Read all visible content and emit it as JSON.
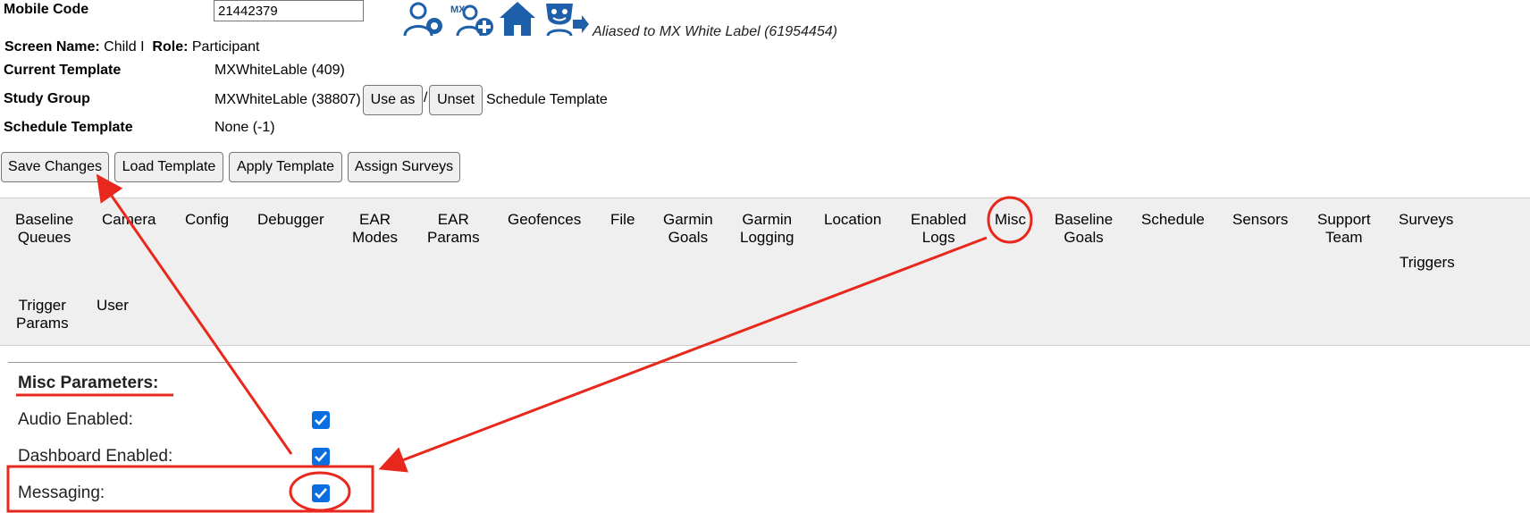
{
  "header": {
    "mobile_code_label": "Mobile Code",
    "mobile_code_value": "21442379",
    "screen_name_label": "Screen Name:",
    "screen_name_value": "Child I",
    "role_label": "Role:",
    "role_value": "Participant",
    "current_template_label": "Current Template",
    "current_template_value": "MXWhiteLable (409)",
    "study_group_label": "Study Group",
    "study_group_value": "MXWhiteLable (38807)",
    "use_as_label": "Use as",
    "slash": "/",
    "unset_label": "Unset",
    "schedule_template_suffix": "Schedule Template",
    "schedule_template_label": "Schedule Template",
    "schedule_template_value": "None (-1)",
    "alias_text": "Aliased to MX White Label (61954454)",
    "icons": [
      "participant-settings-icon",
      "mx-add-user-icon",
      "home-icon",
      "mask-forward-icon"
    ]
  },
  "actions": {
    "save": "Save Changes",
    "load": "Load Template",
    "apply": "Apply Template",
    "assign": "Assign Surveys"
  },
  "tabs": [
    {
      "line1": "Baseline",
      "line2": "Queues"
    },
    {
      "line1": "Camera",
      "line2": ""
    },
    {
      "line1": "Config",
      "line2": ""
    },
    {
      "line1": "Debugger",
      "line2": ""
    },
    {
      "line1": "EAR",
      "line2": "Modes"
    },
    {
      "line1": "EAR",
      "line2": "Params"
    },
    {
      "line1": "Geofences",
      "line2": ""
    },
    {
      "line1": "File",
      "line2": ""
    },
    {
      "line1": "Garmin",
      "line2": "Goals"
    },
    {
      "line1": "Garmin",
      "line2": "Logging"
    },
    {
      "line1": "Location",
      "line2": ""
    },
    {
      "line1": "Enabled",
      "line2": "Logs"
    },
    {
      "line1": "Misc",
      "line2": ""
    },
    {
      "line1": "Baseline",
      "line2": "Goals"
    },
    {
      "line1": "Schedule",
      "line2": ""
    },
    {
      "line1": "Sensors",
      "line2": ""
    },
    {
      "line1": "Support",
      "line2": "Team"
    },
    {
      "line1": "Surveys",
      "line2": ""
    },
    {
      "line1": "Triggers",
      "line2": ""
    },
    {
      "line1": "Trigger",
      "line2": "Params"
    },
    {
      "line1": "User",
      "line2": ""
    }
  ],
  "misc": {
    "title": "Misc Parameters:",
    "params": [
      {
        "label": "Audio Enabled:",
        "checked": true
      },
      {
        "label": "Dashboard Enabled:",
        "checked": true
      },
      {
        "label": "Messaging:",
        "checked": true
      }
    ]
  },
  "colors": {
    "annotation": "#e8281c",
    "checkbox": "#0b6dde",
    "icon_blue": "#1d5fa8",
    "tab_bg": "#efefef"
  }
}
